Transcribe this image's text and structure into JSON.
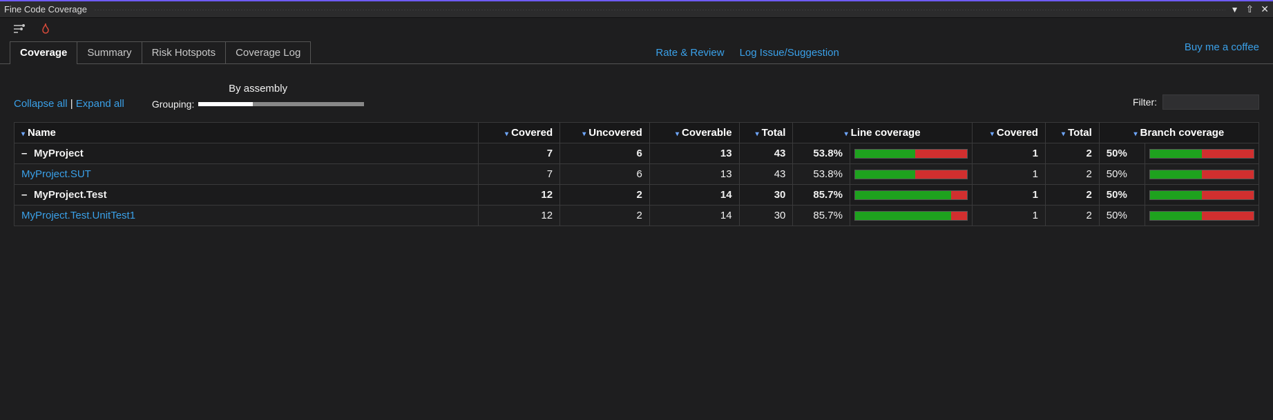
{
  "window": {
    "title": "Fine Code Coverage"
  },
  "tabs": [
    {
      "label": "Coverage",
      "active": true
    },
    {
      "label": "Summary",
      "active": false
    },
    {
      "label": "Risk Hotspots",
      "active": false
    },
    {
      "label": "Coverage Log",
      "active": false
    }
  ],
  "links": {
    "rate_review": "Rate & Review",
    "log_issue": "Log Issue/Suggestion",
    "buy_coffee": "Buy me a coffee"
  },
  "controls": {
    "collapse_all": "Collapse all",
    "expand_all": "Expand all",
    "grouping_label": "Grouping:",
    "grouping_top": "By assembly",
    "filter_label": "Filter:",
    "filter_value": ""
  },
  "headers": {
    "name": "Name",
    "covered": "Covered",
    "uncovered": "Uncovered",
    "coverable": "Coverable",
    "total": "Total",
    "line_coverage": "Line coverage",
    "b_covered": "Covered",
    "b_total": "Total",
    "branch_coverage": "Branch coverage"
  },
  "rows": [
    {
      "type": "group",
      "toggle": "–",
      "name": "MyProject",
      "covered": "7",
      "uncovered": "6",
      "coverable": "13",
      "total": "43",
      "line_pct": "53.8%",
      "line_pct_num": 53.8,
      "b_covered": "1",
      "b_total": "2",
      "b_pct": "50%",
      "b_pct_num": 50
    },
    {
      "type": "leaf",
      "name": "MyProject.SUT",
      "covered": "7",
      "uncovered": "6",
      "coverable": "13",
      "total": "43",
      "line_pct": "53.8%",
      "line_pct_num": 53.8,
      "b_covered": "1",
      "b_total": "2",
      "b_pct": "50%",
      "b_pct_num": 50
    },
    {
      "type": "group",
      "toggle": "–",
      "name": "MyProject.Test",
      "covered": "12",
      "uncovered": "2",
      "coverable": "14",
      "total": "30",
      "line_pct": "85.7%",
      "line_pct_num": 85.7,
      "b_covered": "1",
      "b_total": "2",
      "b_pct": "50%",
      "b_pct_num": 50
    },
    {
      "type": "leaf",
      "name": "MyProject.Test.UnitTest1",
      "covered": "12",
      "uncovered": "2",
      "coverable": "14",
      "total": "30",
      "line_pct": "85.7%",
      "line_pct_num": 85.7,
      "b_covered": "1",
      "b_total": "2",
      "b_pct": "50%",
      "b_pct_num": 50
    }
  ]
}
